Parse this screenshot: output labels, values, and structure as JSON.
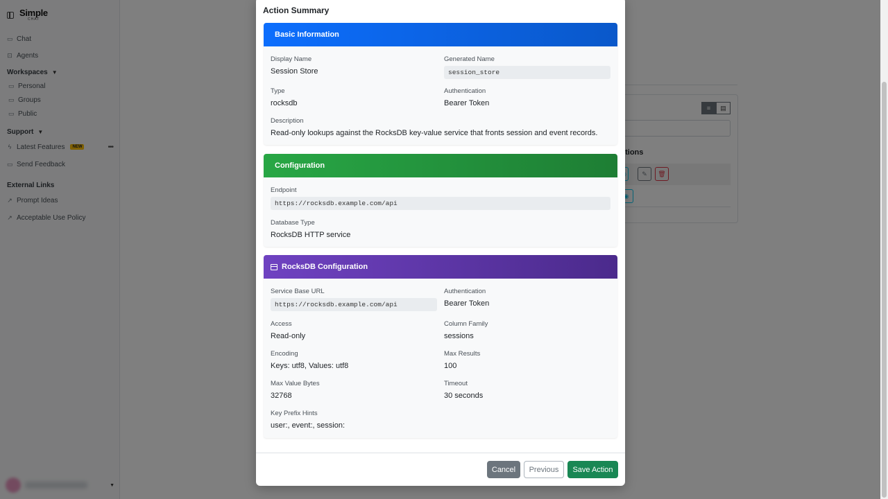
{
  "sidebar": {
    "logo_main": "Simple",
    "logo_sub": "CHAT",
    "items": [
      {
        "label": "Chat",
        "icon": "chat-icon"
      },
      {
        "label": "Agents",
        "icon": "robot-icon"
      }
    ],
    "workspaces": {
      "label": "Workspaces",
      "items": [
        "Personal",
        "Groups",
        "Public"
      ]
    },
    "support": {
      "label": "Support",
      "latest_features": "Latest Features",
      "new_badge": "NEW",
      "send_feedback": "Send Feedback"
    },
    "external_links": {
      "label": "External Links",
      "items": [
        "Prompt Ideas",
        "Acceptable Use Policy"
      ]
    }
  },
  "background": {
    "heading_fragment": "ctions"
  },
  "modal": {
    "title": "Action Summary",
    "basic": {
      "header": "Basic Information",
      "display_name_label": "Display Name",
      "display_name": "Session Store",
      "generated_name_label": "Generated Name",
      "generated_name": "session_store",
      "type_label": "Type",
      "type": "rocksdb",
      "auth_label": "Authentication",
      "auth": "Bearer Token",
      "description_label": "Description",
      "description": "Read-only lookups against the RocksDB key-value service that fronts session and event records."
    },
    "config": {
      "header": "Configuration",
      "endpoint_label": "Endpoint",
      "endpoint": "https://rocksdb.example.com/api",
      "db_type_label": "Database Type",
      "db_type": "RocksDB HTTP service"
    },
    "rocksdb": {
      "header": "RocksDB Configuration",
      "base_url_label": "Service Base URL",
      "base_url": "https://rocksdb.example.com/api",
      "auth_label": "Authentication",
      "auth": "Bearer Token",
      "access_label": "Access",
      "access": "Read-only",
      "column_family_label": "Column Family",
      "column_family": "sessions",
      "encoding_label": "Encoding",
      "encoding": "Keys: utf8, Values: utf8",
      "max_results_label": "Max Results",
      "max_results": "100",
      "max_value_bytes_label": "Max Value Bytes",
      "max_value_bytes": "32768",
      "timeout_label": "Timeout",
      "timeout": "30 seconds",
      "key_prefix_label": "Key Prefix Hints",
      "key_prefix": "user:, event:, session:"
    },
    "footer": {
      "cancel": "Cancel",
      "previous": "Previous",
      "save": "Save Action"
    }
  },
  "colors": {
    "basic_header": "#0d6efd",
    "config_header": "#28a745",
    "rocksdb_header": "#6f42c1",
    "save_button": "#198754",
    "cancel_button": "#6c757d",
    "new_badge": "#ffc107"
  }
}
